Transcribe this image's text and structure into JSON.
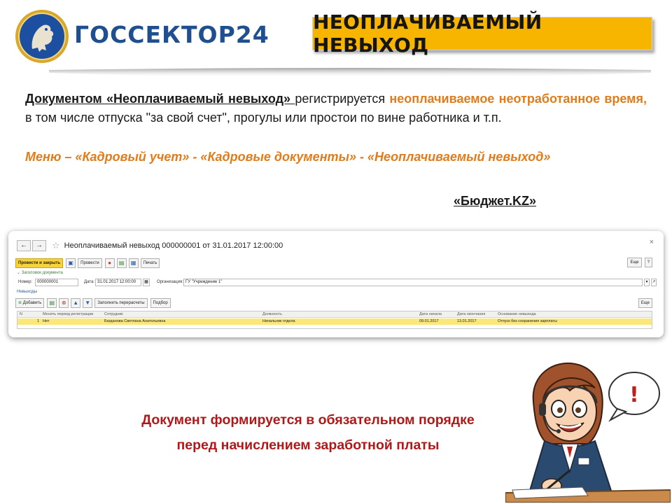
{
  "header": {
    "logo_text": "ГОССЕКТОР24",
    "title": "НЕОПЛАЧИВАЕМЫЙ НЕВЫХОД"
  },
  "description": {
    "part1": "Документом «Неоплачиваемый невыход» ",
    "part2": " регистрируется ",
    "part3": "неоплачиваемое неотработанное время,",
    "part4": " в том числе отпуска \"за свой счет\", прогулы или простои по вине работника и т.п.",
    "menu": "Меню – «Кадровый учет» - «Кадровые документы» - «Неоплачиваемый невыход»",
    "budget": "«Бюджет.KZ»"
  },
  "window": {
    "title": "Неоплачиваемый невыход 000000001 от 31.01.2017 12:00:00",
    "back": "←",
    "forward": "→",
    "close": "×",
    "toolbar": {
      "post_close": "Провести и закрыть",
      "post": "Провести",
      "print": "Печать",
      "more": "Еще",
      "help": "?"
    },
    "section": "Заголовок документа",
    "fields": {
      "number_label": "Номер:",
      "number_value": "000000001",
      "date_label": "Дата:",
      "date_value": "31.01.2017 12:00:00",
      "org_label": "Организация:",
      "org_value": "ГУ \"Учреждение 1\""
    },
    "tab": "Невыходы",
    "table_toolbar": {
      "add": "Добавить",
      "fill": "Заполнить перерасчеты",
      "select": "Подбор",
      "more": "Еще"
    },
    "table": {
      "columns": [
        "N",
        "Менять период регистрации",
        "Сотрудник",
        "Должность",
        "Дата начала",
        "Дата окончания",
        "Основание невыхода"
      ],
      "rows": [
        [
          "1",
          "Нет",
          "Багданова Светлана Анатольевна",
          "Начальник отдела",
          "09.01.2017",
          "13.01.2017",
          "Отпуск без сохранения зарплаты"
        ]
      ]
    }
  },
  "message": {
    "line1": "Документ формируется в обязательном порядке",
    "line2": "перед начислением заработной платы"
  },
  "character": {
    "speech": "!"
  },
  "colors": {
    "title_bg": "#f7b500",
    "accent_orange": "#e07c1b",
    "message_red": "#b01919",
    "logo_blue": "#1f4f8f",
    "row_highlight": "#fbe77a"
  }
}
